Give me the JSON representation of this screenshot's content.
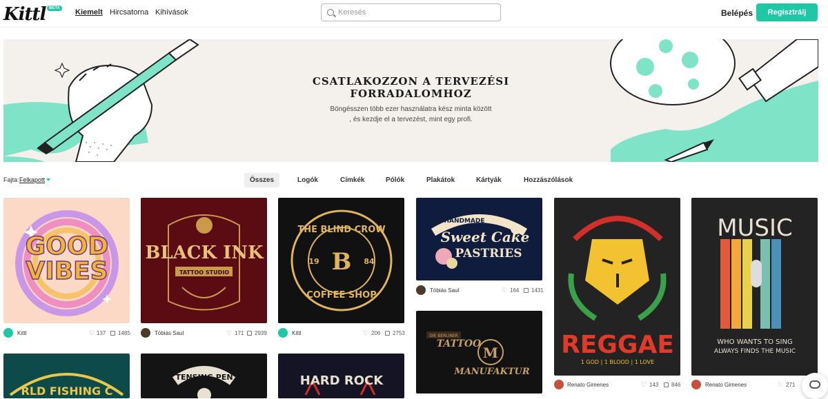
{
  "header": {
    "logo": "Kittl",
    "beta": "BETA",
    "nav": [
      "Kiemelt",
      "Hircsatorna",
      "Kihívások"
    ],
    "search_placeholder": "Keresés",
    "login": "Belépés",
    "register": "Regisztrálj"
  },
  "banner": {
    "title_line1": "CSATLAKOZZON A TERVEZÉSI",
    "title_line2": "FORRADALOMHOZ",
    "subtitle_line1": "Böngésszen több ezer használatra kész minta között",
    "subtitle_line2": ", és kezdje el a tervezést, mint egy profi."
  },
  "filter": {
    "label": "Fajta:",
    "value": "Felkapott"
  },
  "tabs": [
    "Összes",
    "Logók",
    "Címkék",
    "Pólók",
    "Plakátok",
    "Kártyák",
    "Hozzászólások"
  ],
  "cards": [
    {
      "title_a": "GOOD",
      "title_b": "VIBES",
      "author": "Kittl",
      "likes": "137",
      "copies": "1485"
    },
    {
      "title_a": "BLACK INK",
      "title_b": "TATTOO STUDIO",
      "author": "Tóbiás Saul",
      "likes": "171",
      "copies": "2939"
    },
    {
      "title_a": "THE BLIND CROW",
      "title_b": "COFFEE SHOP",
      "num_a": "19",
      "num_b": "84",
      "author": "Kittl",
      "likes": "206",
      "copies": "2753"
    },
    {
      "title_a": "Sweet Cake",
      "title_b": "PASTRIES",
      "top": "HANDMADE",
      "author": "Tóbiás Saul",
      "likes": "164",
      "copies": "1431"
    },
    {
      "title_a": "TATTOO",
      "title_b": "MANUFAKTUR",
      "top": "DIE BERLINER",
      "author": "",
      "likes": "",
      "copies": ""
    },
    {
      "title_a": "REGGAE",
      "title_b": "1 GOD | 1 BLOOD | 1 LOVE",
      "author": "Renato Gimenes",
      "likes": "143",
      "copies": "846"
    },
    {
      "title_a": "MUSIC",
      "title_b": "WHO WANTS TO SING",
      "title_c": "ALWAYS FINDS THE MUSIC",
      "author": "Renato Gimenes",
      "likes": "271",
      "copies": ""
    },
    {
      "title_a": "RLD FISHING C",
      "author": "",
      "likes": "",
      "copies": ""
    },
    {
      "title_a": "TENSING PEN",
      "author": "",
      "likes": "",
      "copies": ""
    },
    {
      "title_a": "HARD ROCK",
      "author": "",
      "likes": "",
      "copies": ""
    }
  ],
  "colors": {
    "accent": "#1ec8a5",
    "banner_bg": "#f4f1ed"
  }
}
